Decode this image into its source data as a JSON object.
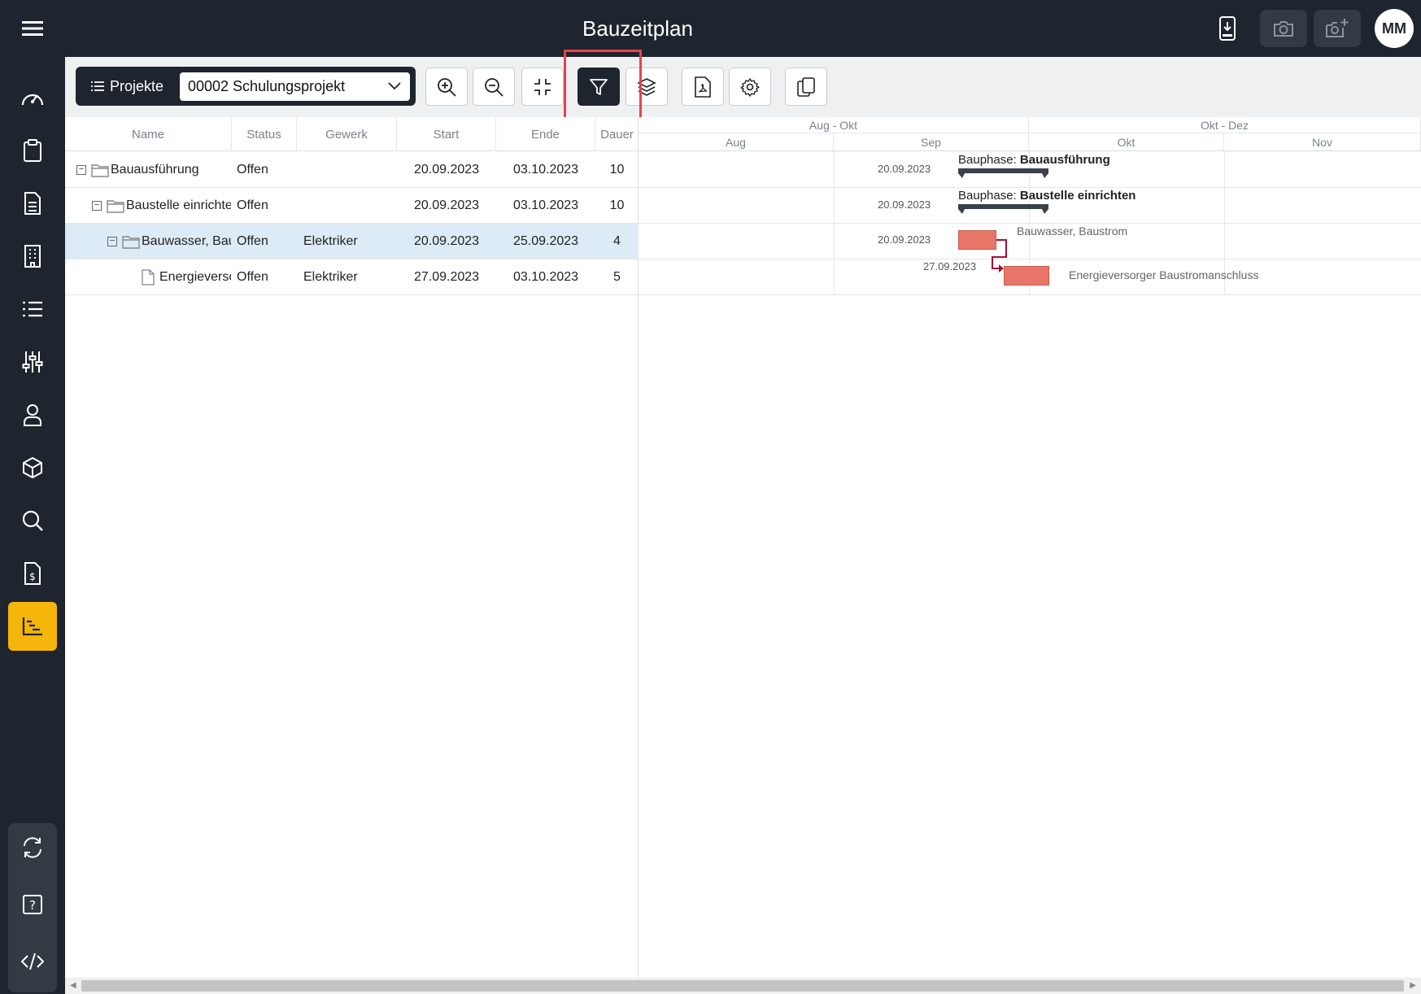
{
  "app": {
    "title": "Bauzeitplan",
    "avatar_initials": "MM"
  },
  "toolbar": {
    "projects_label": "Projekte",
    "project_selected": "00002 Schulungsprojekt"
  },
  "grid": {
    "columns": [
      "Name",
      "Status",
      "Gewerk",
      "Start",
      "Ende",
      "Dauer"
    ],
    "rows": [
      {
        "name": "Bauausführung",
        "status": "Offen",
        "gewerk": "",
        "start": "20.09.2023",
        "end": "03.10.2023",
        "duration": "10"
      },
      {
        "name": "Baustelle einrichten",
        "status": "Offen",
        "gewerk": "",
        "start": "20.09.2023",
        "end": "03.10.2023",
        "duration": "10"
      },
      {
        "name": "Bauwasser, Baustrom",
        "status": "Offen",
        "gewerk": "Elektriker",
        "start": "20.09.2023",
        "end": "25.09.2023",
        "duration": "4"
      },
      {
        "name": "Energieversorger Baustromanschluss",
        "status": "Offen",
        "gewerk": "Elektriker",
        "start": "27.09.2023",
        "end": "03.10.2023",
        "duration": "5"
      }
    ]
  },
  "gantt": {
    "scale_top": [
      "Aug - Okt",
      "Okt - Dez"
    ],
    "scale_bottom": [
      "Aug",
      "Sep",
      "Okt",
      "Nov"
    ],
    "phase_prefix": "Bauphase:",
    "phase1_name": "Bauausführung",
    "phase2_name": "Baustelle einrichten",
    "date1": "20.09.2023",
    "date2": "20.09.2023",
    "date3": "20.09.2023",
    "date4": "27.09.2023",
    "task1_label": "Bauwasser, Baustrom",
    "task2_label": "Energieversorger Baustromanschluss"
  },
  "colors": {
    "dark": "#1f252e",
    "accent": "#f5b50a",
    "task_bar": "#e8776a",
    "dependency": "#a0103a",
    "highlight": "#e8424a",
    "selected_row": "#dcebf5"
  }
}
